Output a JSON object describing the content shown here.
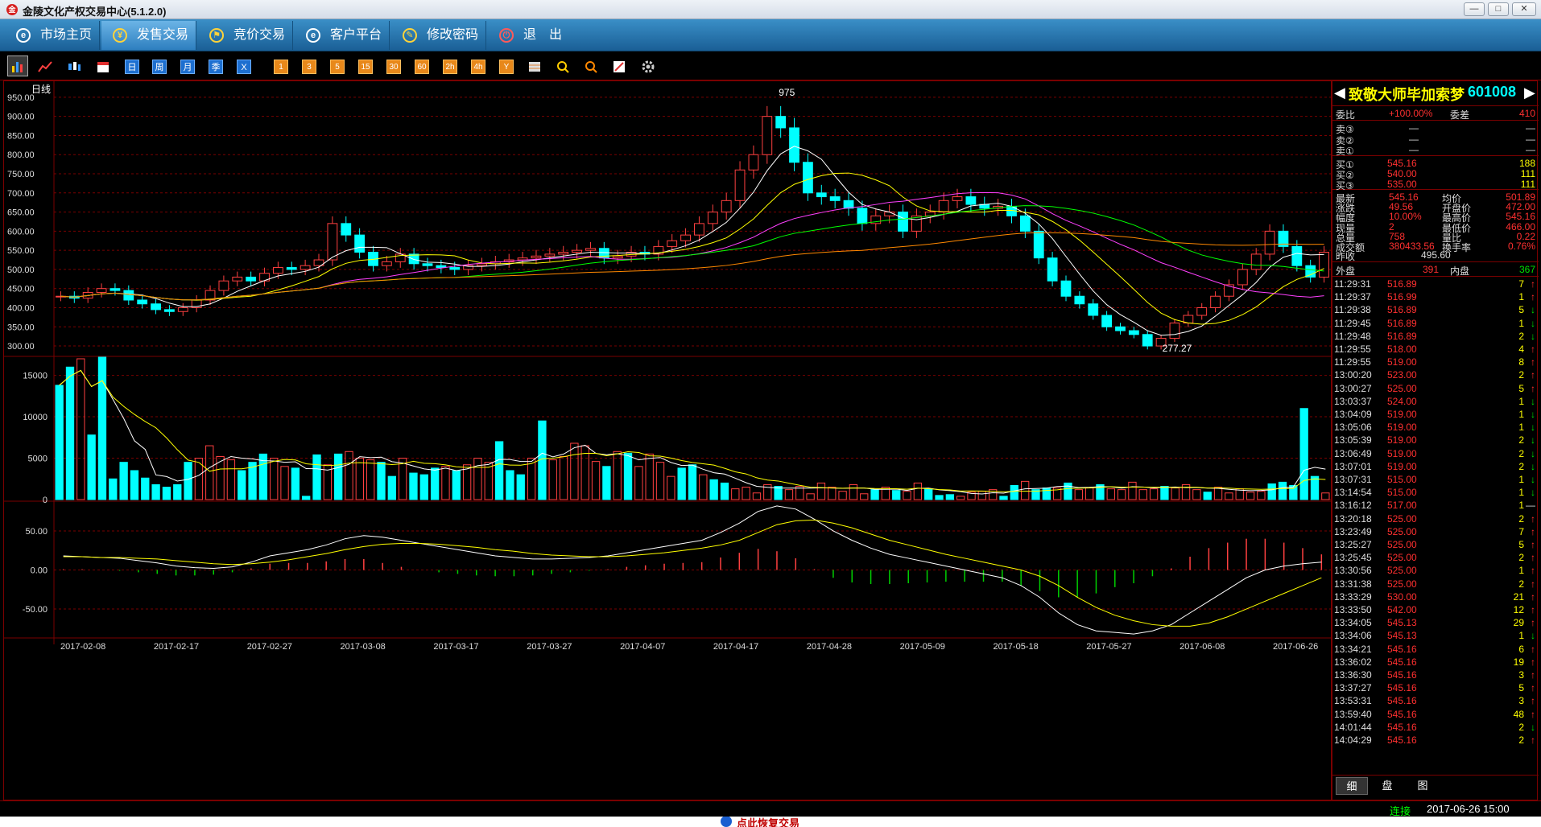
{
  "window": {
    "title": "金陵文化产权交易中心(5.1.2.0)",
    "logo": "金"
  },
  "nav": [
    {
      "label": "市场主页",
      "icon": "e"
    },
    {
      "label": "发售交易",
      "icon": "¥"
    },
    {
      "label": "竞价交易",
      "icon": "⚑"
    },
    {
      "label": "客户平台",
      "icon": "e"
    },
    {
      "label": "修改密码",
      "icon": "✎"
    },
    {
      "label": "退　出",
      "icon": "⏻"
    }
  ],
  "toolbar": {
    "periods": [
      "日",
      "周",
      "月",
      "季",
      "X"
    ],
    "minutes": [
      "1",
      "3",
      "5",
      "15",
      "30",
      "60",
      "2h",
      "4h",
      "Y"
    ]
  },
  "chart": {
    "period_label": "日线",
    "high_label": "975",
    "low_label": "277.27"
  },
  "chart_data": {
    "type": "candlestick",
    "price_axis": {
      "ylim": [
        277,
        975
      ],
      "ticks": [
        "950.00",
        "900.00",
        "850.00",
        "800.00",
        "750.00",
        "700.00",
        "650.00",
        "600.00",
        "550.00",
        "500.00",
        "450.00",
        "400.00",
        "350.00",
        "300.00"
      ]
    },
    "volume_axis": {
      "ylim": [
        0,
        17000
      ],
      "ticks": [
        "15000",
        "10000",
        "5000",
        "0"
      ]
    },
    "macd_axis": {
      "ylim": [
        -85,
        85
      ],
      "ticks": [
        "50.00",
        "0.00",
        "-50.00"
      ]
    },
    "x_ticks": [
      "2017-02-08",
      "2017-02-17",
      "2017-02-27",
      "2017-03-08",
      "2017-03-17",
      "2017-03-27",
      "2017-04-07",
      "2017-04-17",
      "2017-04-28",
      "2017-05-09",
      "2017-05-18",
      "2017-05-27",
      "2017-06-08",
      "2017-06-26"
    ],
    "close": [
      430,
      425,
      440,
      450,
      445,
      420,
      410,
      395,
      390,
      400,
      420,
      445,
      470,
      480,
      470,
      490,
      505,
      500,
      510,
      525,
      620,
      590,
      545,
      510,
      520,
      540,
      515,
      510,
      505,
      500,
      510,
      515,
      520,
      525,
      530,
      535,
      540,
      545,
      550,
      555,
      530,
      535,
      545,
      540,
      560,
      575,
      590,
      620,
      650,
      680,
      760,
      800,
      900,
      870,
      780,
      700,
      690,
      680,
      660,
      620,
      640,
      650,
      600,
      640,
      650,
      680,
      690,
      670,
      660,
      665,
      640,
      600,
      530,
      470,
      430,
      410,
      380,
      350,
      340,
      330,
      300,
      320,
      360,
      380,
      400,
      430,
      460,
      500,
      540,
      600,
      560,
      510,
      480,
      545
    ],
    "volume": [
      13800,
      16000,
      17000,
      7800,
      17200,
      2500,
      4500,
      3500,
      2600,
      1800,
      1500,
      1800,
      4500,
      5000,
      6500,
      5200,
      4800,
      3500,
      4500,
      5500,
      5000,
      4000,
      3800,
      400,
      5400,
      4200,
      5500,
      5800,
      5000,
      4800,
      4500,
      2800,
      5000,
      3200,
      3000,
      3800,
      4000,
      3500,
      4200,
      5000,
      4500,
      7000,
      3500,
      3000,
      5000,
      9500,
      4800,
      5200,
      6800,
      6500,
      4600,
      4000,
      5800,
      5600,
      4000,
      5500,
      4500,
      2800,
      3800,
      4200,
      3000,
      2400,
      2000,
      1300,
      1500,
      800,
      1800,
      1600,
      1200,
      1600,
      700,
      2000,
      1500,
      1000,
      1800,
      700,
      1200,
      1500,
      1100,
      1000,
      2000,
      1300,
      500,
      600,
      400,
      900,
      1000,
      1200,
      400,
      1700,
      2200,
      1200,
      1400,
      1400,
      2000,
      1200,
      1400,
      1800,
      1300,
      1200,
      2100,
      1200,
      1300,
      1600,
      1400,
      1800,
      1200,
      900,
      1500,
      800,
      1300,
      900,
      1000,
      1900,
      2100,
      1700,
      11000,
      2800,
      800
    ],
    "volume_colors": [
      "cyan",
      "cyan",
      "red",
      "cyan",
      "cyan",
      "cyan",
      "cyan",
      "cyan",
      "cyan",
      "cyan",
      "cyan",
      "cyan",
      "cyan",
      "red",
      "red",
      "red",
      "red",
      "cyan",
      "cyan",
      "cyan",
      "red",
      "red",
      "cyan",
      "cyan",
      "cyan",
      "red",
      "cyan",
      "red",
      "red",
      "red",
      "cyan",
      "cyan",
      "red",
      "cyan",
      "cyan",
      "cyan",
      "red",
      "cyan",
      "red",
      "red",
      "red",
      "cyan",
      "cyan",
      "cyan",
      "red",
      "cyan",
      "red",
      "red",
      "red",
      "red",
      "red",
      "cyan",
      "red",
      "cyan",
      "red",
      "red",
      "red",
      "red",
      "cyan",
      "cyan",
      "red",
      "cyan",
      "cyan",
      "red",
      "red",
      "red",
      "red",
      "cyan",
      "red",
      "red",
      "red",
      "red",
      "red",
      "red",
      "red",
      "red",
      "cyan",
      "red",
      "cyan",
      "red",
      "red",
      "cyan",
      "cyan",
      "cyan",
      "red",
      "red",
      "red",
      "red",
      "cyan",
      "cyan",
      "red",
      "cyan",
      "cyan",
      "red",
      "cyan",
      "red",
      "red",
      "cyan",
      "red",
      "red",
      "red",
      "red",
      "red",
      "cyan",
      "red",
      "red",
      "red",
      "cyan",
      "red",
      "red",
      "red",
      "red",
      "red",
      "cyan",
      "cyan",
      "cyan",
      "cyan",
      "cyan",
      "red"
    ],
    "macd_dif": [
      18,
      17,
      16,
      15,
      12,
      9,
      5,
      3,
      2,
      4,
      10,
      18,
      22,
      26,
      32,
      40,
      44,
      42,
      38,
      34,
      30,
      26,
      22,
      18,
      16,
      14,
      14,
      15,
      16,
      18,
      22,
      26,
      30,
      34,
      38,
      48,
      60,
      75,
      82,
      78,
      65,
      50,
      38,
      28,
      20,
      15,
      10,
      5,
      0,
      -5,
      -10,
      -20,
      -35,
      -55,
      -70,
      -78,
      -80,
      -82,
      -78,
      -70,
      -55,
      -40,
      -25,
      -10,
      0,
      5,
      8,
      10
    ],
    "macd_dea": [
      17,
      17,
      16,
      16,
      15,
      14,
      12,
      10,
      8,
      7,
      8,
      10,
      13,
      17,
      21,
      26,
      30,
      33,
      34,
      34,
      33,
      31,
      29,
      26,
      24,
      21,
      19,
      18,
      17,
      17,
      18,
      20,
      22,
      25,
      28,
      32,
      38,
      48,
      58,
      63,
      64,
      60,
      54,
      46,
      38,
      32,
      26,
      20,
      15,
      10,
      5,
      0,
      -8,
      -20,
      -35,
      -48,
      -58,
      -65,
      -70,
      -72,
      -72,
      -68,
      -60,
      -50,
      -40,
      -30,
      -20,
      -10
    ],
    "macd_hist": [
      1,
      1,
      0,
      -1,
      -3,
      -5,
      -7,
      -7,
      -6,
      -3,
      2,
      8,
      9,
      9,
      11,
      14,
      14,
      9,
      4,
      0,
      -3,
      -5,
      -7,
      -8,
      -8,
      -7,
      -5,
      -3,
      -1,
      1,
      4,
      6,
      8,
      9,
      10,
      16,
      22,
      27,
      24,
      15,
      1,
      -10,
      -16,
      -18,
      -18,
      -17,
      -16,
      -15,
      -15,
      -15,
      -15,
      -20,
      -27,
      -35,
      -35,
      -30,
      -22,
      -17,
      -8,
      2,
      17,
      28,
      35,
      40,
      40,
      35,
      28,
      20
    ]
  },
  "stock": {
    "name": "致敬大师毕加索梦",
    "code": "601008"
  },
  "quote": {
    "wb_label": "委比",
    "wb_val": "+100.00%",
    "wc_label": "委差",
    "wc_val": "410",
    "sells": [
      {
        "label": "卖③",
        "price": "—",
        "vol": "—"
      },
      {
        "label": "卖②",
        "price": "—",
        "vol": "—"
      },
      {
        "label": "卖①",
        "price": "—",
        "vol": "—"
      }
    ],
    "buys": [
      {
        "label": "买①",
        "price": "545.16",
        "vol": "188"
      },
      {
        "label": "买②",
        "price": "540.00",
        "vol": "111"
      },
      {
        "label": "买③",
        "price": "535.00",
        "vol": "111"
      }
    ],
    "stats": [
      {
        "l1": "最新",
        "v1": "545.16",
        "l2": "均价",
        "v2": "501.89"
      },
      {
        "l1": "涨跌",
        "v1": "49.56",
        "l2": "开盘价",
        "v2": "472.00"
      },
      {
        "l1": "幅度",
        "v1": "10.00%",
        "l2": "最高价",
        "v2": "545.16"
      },
      {
        "l1": "现量",
        "v1": "2",
        "l2": "最低价",
        "v2": "466.00"
      },
      {
        "l1": "总量",
        "v1": "758",
        "l2": "量比",
        "v2": "0.22"
      },
      {
        "l1": "成交额",
        "v1": "380433.56",
        "l2": "换手率",
        "v2": "0.76%"
      }
    ],
    "prev_label": "昨收",
    "prev_val": "495.60",
    "outer_label": "外盘",
    "outer_val": "391",
    "inner_label": "内盘",
    "inner_val": "367"
  },
  "ticks": [
    {
      "t": "11:29:31",
      "p": "516.89",
      "v": "7",
      "d": "↑"
    },
    {
      "t": "11:29:37",
      "p": "516.99",
      "v": "1",
      "d": "↑"
    },
    {
      "t": "11:29:38",
      "p": "516.89",
      "v": "5",
      "d": "↓"
    },
    {
      "t": "11:29:45",
      "p": "516.89",
      "v": "1",
      "d": "↓"
    },
    {
      "t": "11:29:48",
      "p": "516.89",
      "v": "2",
      "d": "↓"
    },
    {
      "t": "11:29:55",
      "p": "518.00",
      "v": "4",
      "d": "↑"
    },
    {
      "t": "11:29:55",
      "p": "519.00",
      "v": "8",
      "d": "↑"
    },
    {
      "t": "13:00:20",
      "p": "523.00",
      "v": "2",
      "d": "↑"
    },
    {
      "t": "13:00:27",
      "p": "525.00",
      "v": "5",
      "d": "↑"
    },
    {
      "t": "13:03:37",
      "p": "524.00",
      "v": "1",
      "d": "↓"
    },
    {
      "t": "13:04:09",
      "p": "519.00",
      "v": "1",
      "d": "↓"
    },
    {
      "t": "13:05:06",
      "p": "519.00",
      "v": "1",
      "d": "↓"
    },
    {
      "t": "13:05:39",
      "p": "519.00",
      "v": "2",
      "d": "↓"
    },
    {
      "t": "13:06:49",
      "p": "519.00",
      "v": "2",
      "d": "↓"
    },
    {
      "t": "13:07:01",
      "p": "519.00",
      "v": "2",
      "d": "↓"
    },
    {
      "t": "13:07:31",
      "p": "515.00",
      "v": "1",
      "d": "↓"
    },
    {
      "t": "13:14:54",
      "p": "515.00",
      "v": "1",
      "d": "↓"
    },
    {
      "t": "13:16:12",
      "p": "517.00",
      "v": "1",
      "d": "—"
    },
    {
      "t": "13:20:18",
      "p": "525.00",
      "v": "2",
      "d": "↑"
    },
    {
      "t": "13:23:49",
      "p": "525.00",
      "v": "7",
      "d": "↑"
    },
    {
      "t": "13:25:27",
      "p": "525.00",
      "v": "5",
      "d": "↑"
    },
    {
      "t": "13:25:45",
      "p": "525.00",
      "v": "2",
      "d": "↑"
    },
    {
      "t": "13:30:56",
      "p": "525.00",
      "v": "1",
      "d": "↑"
    },
    {
      "t": "13:31:38",
      "p": "525.00",
      "v": "2",
      "d": "↑"
    },
    {
      "t": "13:33:29",
      "p": "530.00",
      "v": "21",
      "d": "↑"
    },
    {
      "t": "13:33:50",
      "p": "542.00",
      "v": "12",
      "d": "↑"
    },
    {
      "t": "13:34:05",
      "p": "545.13",
      "v": "29",
      "d": "↑"
    },
    {
      "t": "13:34:06",
      "p": "545.13",
      "v": "1",
      "d": "↓"
    },
    {
      "t": "13:34:21",
      "p": "545.16",
      "v": "6",
      "d": "↑"
    },
    {
      "t": "13:36:02",
      "p": "545.16",
      "v": "19",
      "d": "↑"
    },
    {
      "t": "13:36:30",
      "p": "545.16",
      "v": "3",
      "d": "↑"
    },
    {
      "t": "13:37:27",
      "p": "545.16",
      "v": "5",
      "d": "↑"
    },
    {
      "t": "13:53:31",
      "p": "545.16",
      "v": "3",
      "d": "↑"
    },
    {
      "t": "13:59:40",
      "p": "545.16",
      "v": "48",
      "d": "↑"
    },
    {
      "t": "14:01:44",
      "p": "545.16",
      "v": "2",
      "d": "↓"
    },
    {
      "t": "14:04:29",
      "p": "545.16",
      "v": "2",
      "d": "↑"
    }
  ],
  "tabs": [
    "细",
    "盘",
    "图"
  ],
  "status": {
    "conn": "连接",
    "datetime": "2017-06-26 15:00"
  },
  "bottom": {
    "text": "点此恢复交易"
  }
}
